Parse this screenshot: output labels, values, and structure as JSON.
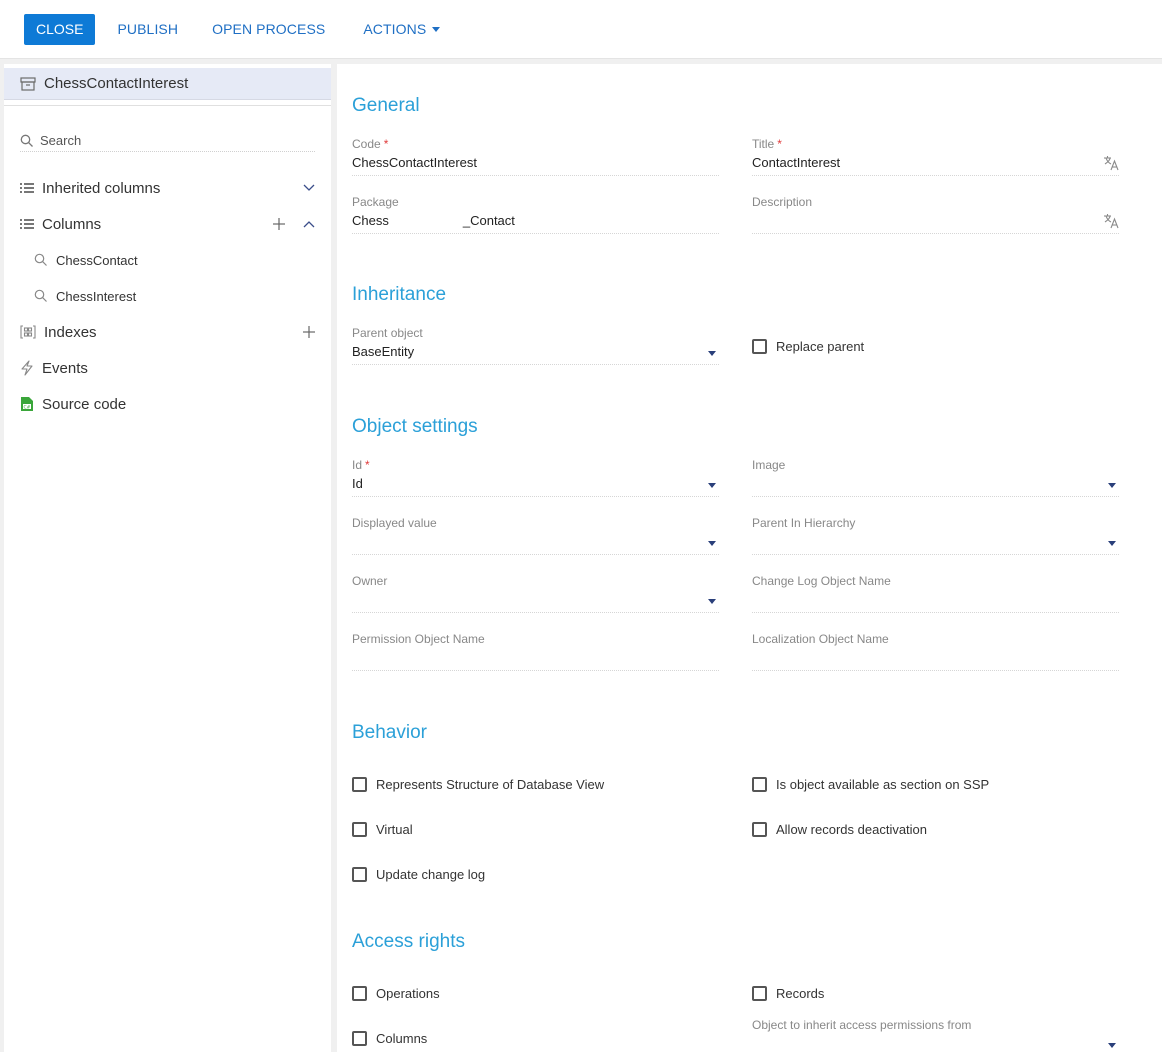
{
  "toolbar": {
    "close_label": "CLOSE",
    "publish_label": "PUBLISH",
    "open_process_label": "OPEN PROCESS",
    "actions_label": "ACTIONS"
  },
  "sidebar": {
    "object_name": "ChessContactInterest",
    "search_placeholder": "Search",
    "inherited_columns": "Inherited columns",
    "columns": "Columns",
    "column_items": [
      "ChessContact",
      "ChessInterest"
    ],
    "indexes": "Indexes",
    "events": "Events",
    "source_code": "Source code"
  },
  "general": {
    "title": "General",
    "code_label": "Code",
    "code_value": "ChessContactInterest",
    "title_label": "Title",
    "title_value": "ContactInterest",
    "package_label": "Package",
    "package_value_start": "Chess",
    "package_value_end": "_Contact",
    "description_label": "Description",
    "description_value": ""
  },
  "inheritance": {
    "title": "Inheritance",
    "parent_label": "Parent object",
    "parent_value": "BaseEntity",
    "replace_parent": "Replace parent"
  },
  "object_settings": {
    "title": "Object settings",
    "id_label": "Id",
    "id_value": "Id",
    "image_label": "Image",
    "displayed_label": "Displayed value",
    "parent_hierarchy_label": "Parent In Hierarchy",
    "owner_label": "Owner",
    "change_log_label": "Change Log Object Name",
    "permission_label": "Permission Object Name",
    "localization_label": "Localization Object Name"
  },
  "behavior": {
    "title": "Behavior",
    "represents_db_view": "Represents Structure of Database View",
    "ssp_section": "Is object available as section on SSP",
    "virtual": "Virtual",
    "allow_deactivation": "Allow records deactivation",
    "update_change_log": "Update change log"
  },
  "access_rights": {
    "title": "Access rights",
    "operations": "Operations",
    "records": "Records",
    "columns": "Columns",
    "inherit_from_label": "Object to inherit access permissions from"
  },
  "colors": {
    "accent_button": "#0e7ad6",
    "link": "#1f6fc4",
    "section_title": "#2ba0d8",
    "required": "#e03a3a",
    "selected_bg": "#e6eaf6"
  }
}
